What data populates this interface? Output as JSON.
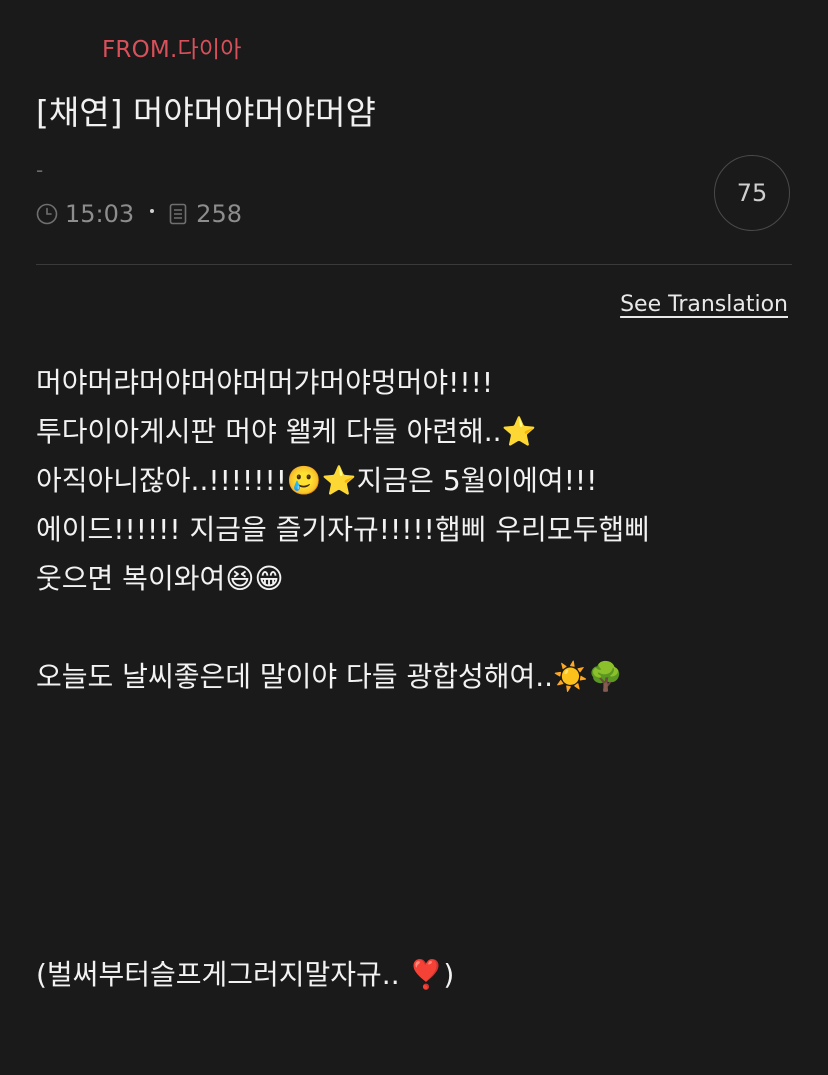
{
  "post": {
    "from": "FROM.다이아",
    "title": "[채연] 머야머야머야머얌",
    "dash": "-",
    "time": "15:03",
    "views": "258",
    "count": "75"
  },
  "translate_label": "See Translation",
  "body_lines": [
    "머야머랴머야머야머머갸머야멍머야!!!!",
    "투다이아게시판 머야 왤케 다들 아련해..⭐",
    "아직아니잖아..!!!!!!!🥲⭐지금은 5월이에여!!!",
    "에이드!!!!!! 지금을 즐기자규!!!!!햅삐 우리모두햅삐",
    "웃으면 복이와여😆😁",
    "",
    "오늘도 날씨좋은데 말이야 다들 광합성해여..☀️🌳"
  ],
  "footer_line": "(벌써부터슬프게그러지말자규.. ❣️)",
  "icons": {
    "time": "clock-icon",
    "views": "document-icon"
  }
}
